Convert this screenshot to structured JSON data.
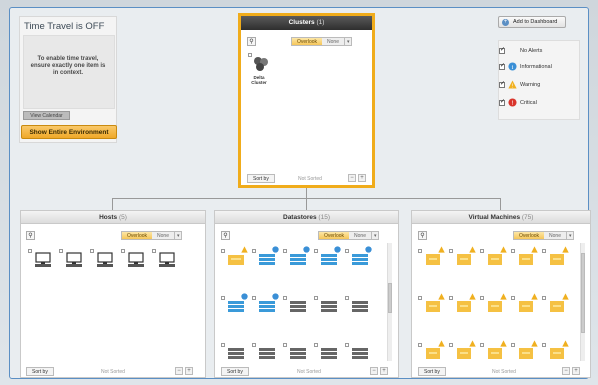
{
  "time_travel": {
    "title": "Time Travel is OFF",
    "message": "To enable time travel, ensure exactly one item is in context.",
    "view_calendar_label": "View Calendar",
    "show_environment_label": "Show Entire Environment"
  },
  "dashboard": {
    "add_label": "Add to Dashboard"
  },
  "legend": [
    {
      "label": "No Alerts",
      "icon": "none"
    },
    {
      "label": "Informational",
      "icon": "info-icon",
      "color": "#3a8fd6"
    },
    {
      "label": "Warning",
      "icon": "warning-icon",
      "color": "#f0b020"
    },
    {
      "label": "Critical",
      "icon": "critical-icon",
      "color": "#d9342b"
    }
  ],
  "clusters": {
    "title": "Clusters",
    "count": "(1)",
    "toggle_active": "Overlook",
    "toggle_inactive": "None",
    "items": [
      {
        "name": "Delta Cluster"
      }
    ],
    "sort_label": "Sort by",
    "sort_status": "Not Sorted"
  },
  "hosts": {
    "title": "Hosts",
    "count": "(5)",
    "toggle_active": "Overlook",
    "toggle_inactive": "None",
    "sort_label": "Sort by",
    "sort_status": "Not Sorted"
  },
  "datastores": {
    "title": "Datastores",
    "count": "(15)",
    "toggle_active": "Overlook",
    "toggle_inactive": "None",
    "sort_label": "Sort by",
    "sort_status": "Not Sorted"
  },
  "vms": {
    "title": "Virtual Machines",
    "count": "(75)",
    "toggle_active": "Overlook",
    "toggle_inactive": "None",
    "sort_label": "Sort by",
    "sort_status": "Not Sorted"
  }
}
